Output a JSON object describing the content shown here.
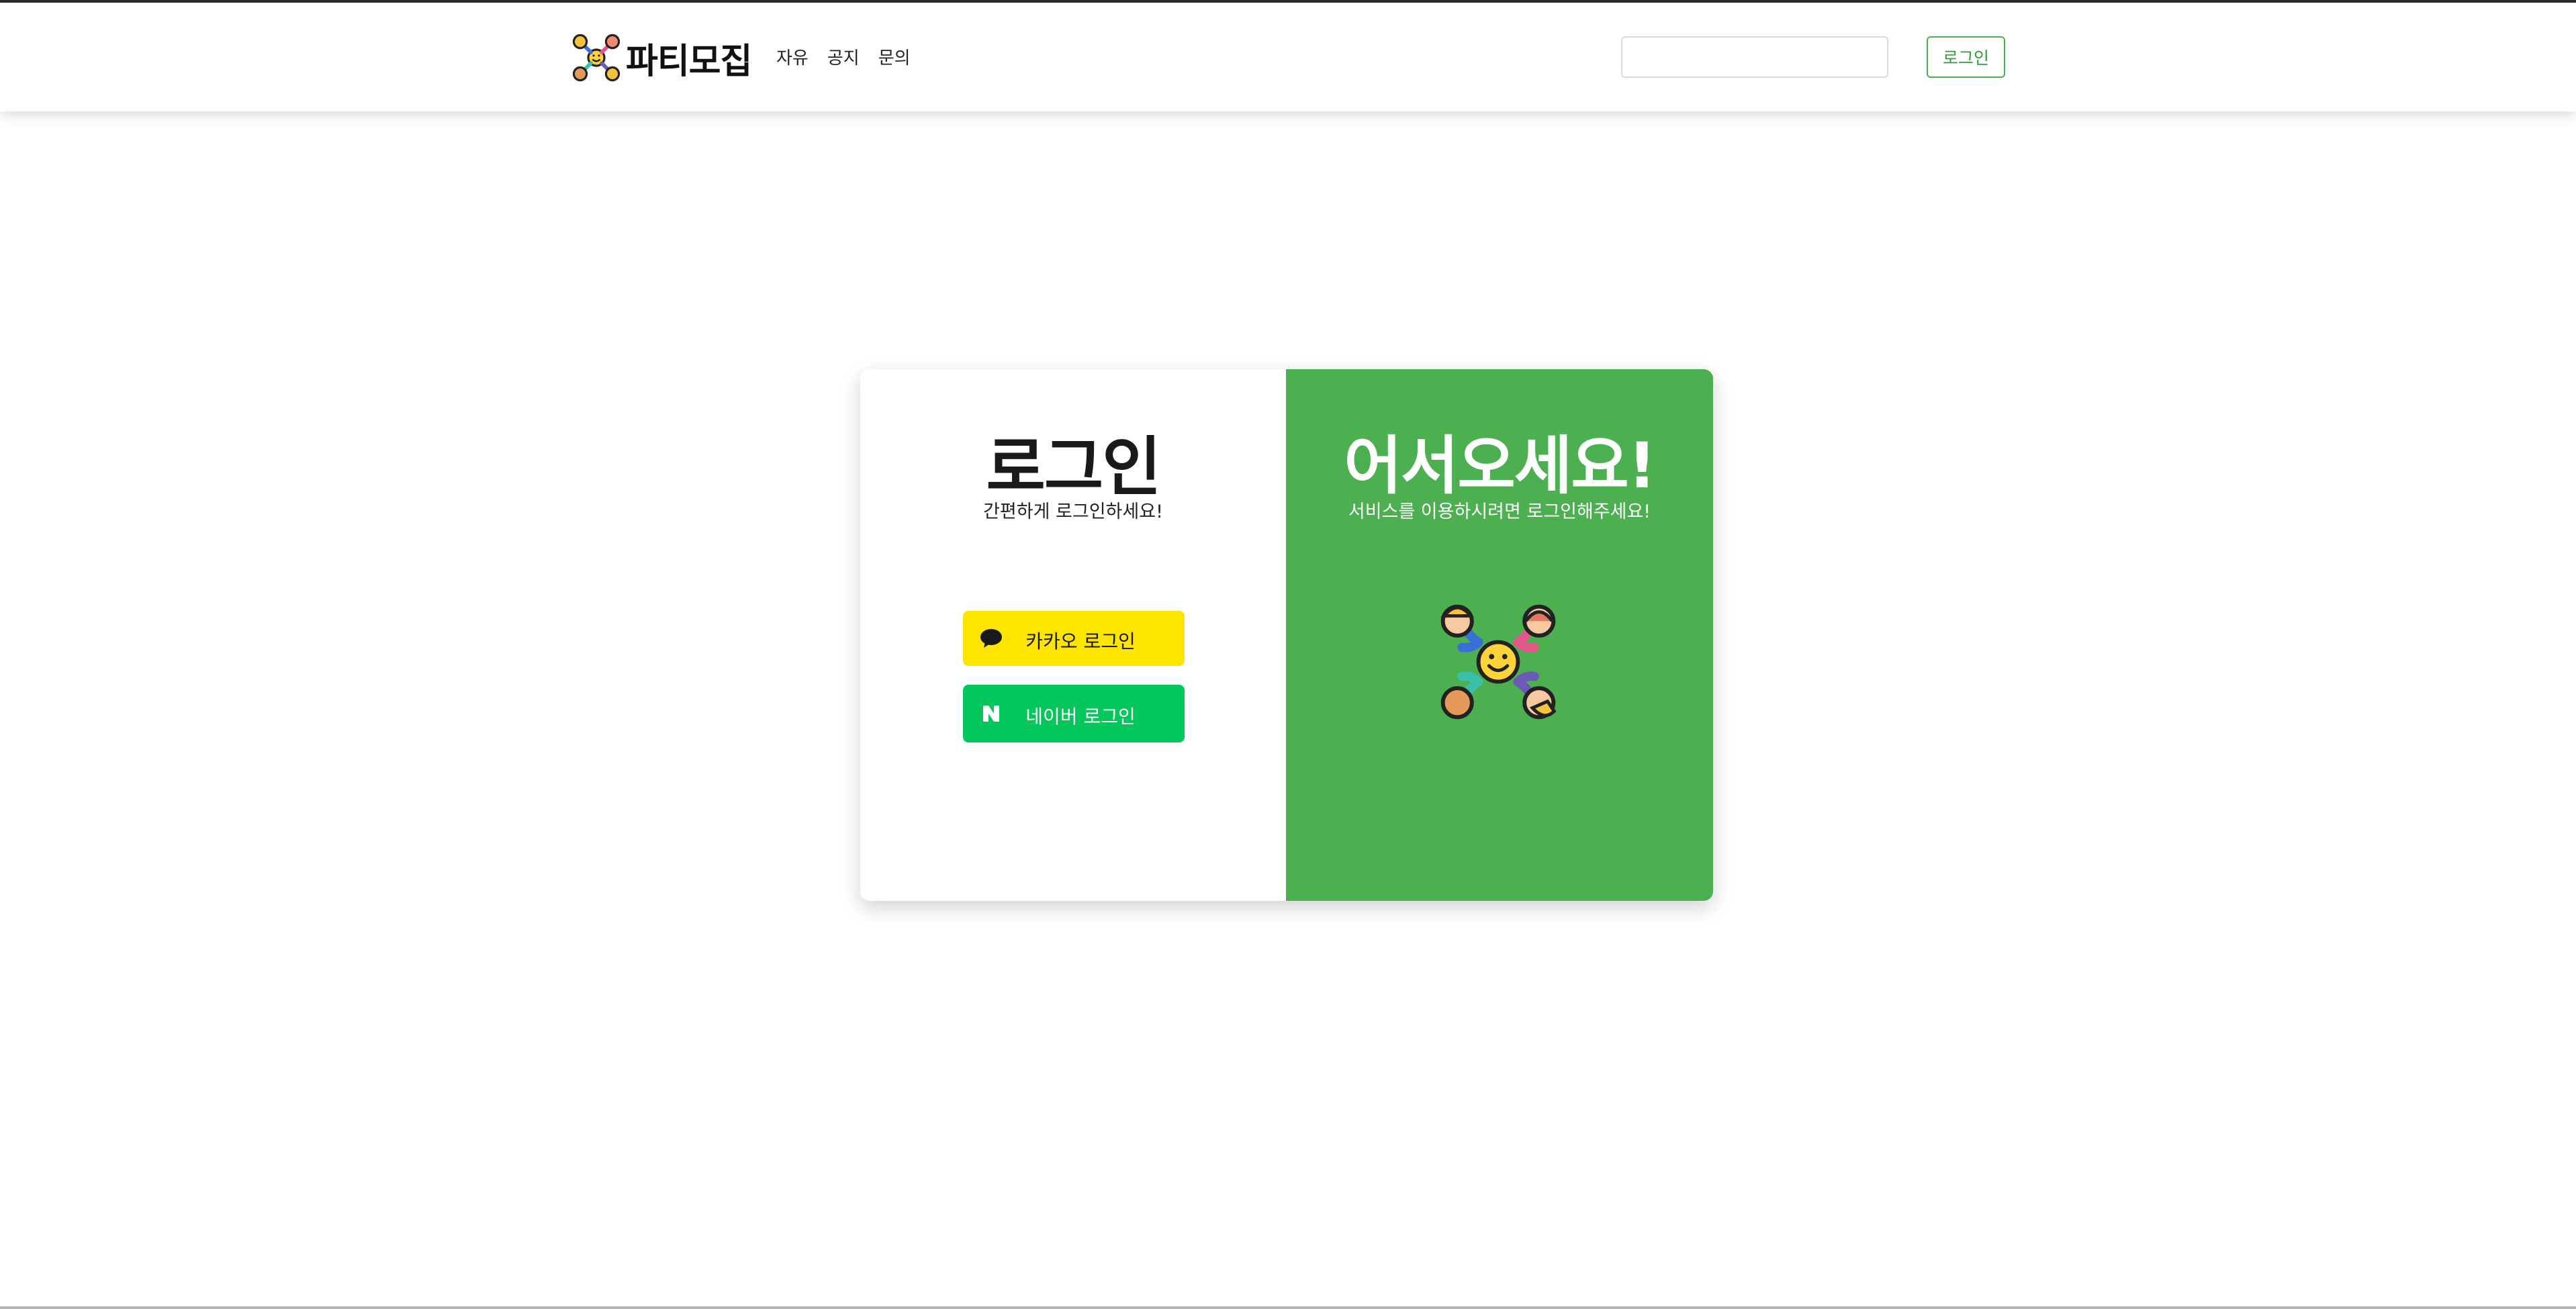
{
  "navbar": {
    "brand_name": "파티모집",
    "links": [
      "자유",
      "공지",
      "문의"
    ],
    "search": {
      "value": "",
      "placeholder": ""
    },
    "login_label": "로그인"
  },
  "login_card": {
    "left": {
      "title": "로그인",
      "subtitle": "간편하게 로그인하세요!",
      "kakao_button": {
        "label": "카카오 로그인",
        "icon": "speech-bubble-icon",
        "color": "#FEE500"
      },
      "naver_button": {
        "label": "네이버 로그인",
        "icon": "naver-n-icon",
        "color": "#03C75A"
      }
    },
    "right": {
      "title": "어서오세요!",
      "subtitle": "서비스를 이용하시려면 로그인해주세요!",
      "illustration": "party-people-icon",
      "background": "#4CAF50"
    }
  },
  "colors": {
    "accent": "#4CAF50",
    "nav_login_text": "#2E9D3A"
  }
}
